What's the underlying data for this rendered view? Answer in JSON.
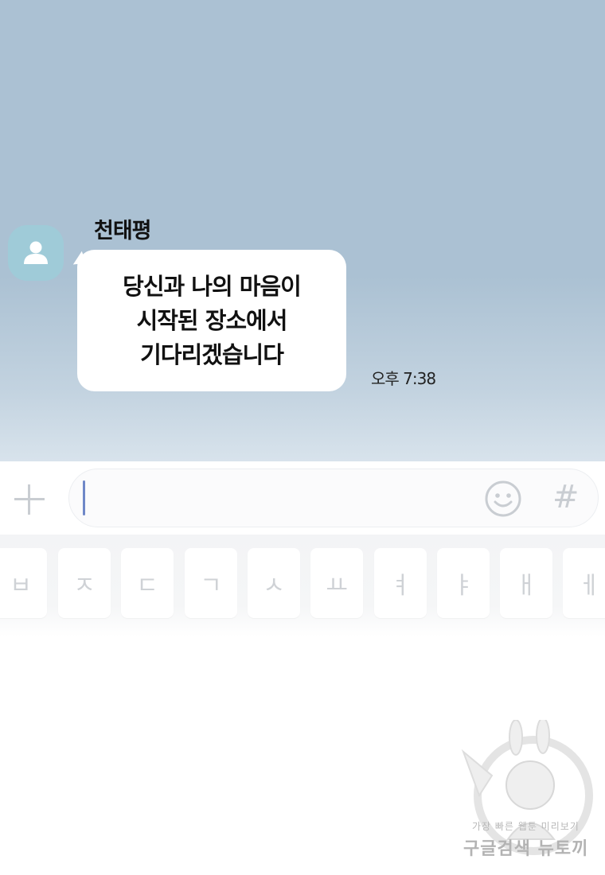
{
  "chat": {
    "sender_name": "천태평",
    "message_lines": [
      "당신과 나의 마음이",
      "시작된 장소에서",
      "기다리겠습니다"
    ],
    "timestamp": "오후 7:38"
  },
  "input_bar": {
    "plus_icon": "plus-icon",
    "emoji_icon": "smiley-icon",
    "hash_label": "#"
  },
  "keyboard": {
    "keys": [
      "ㅂ",
      "ㅈ",
      "ㄷ",
      "ㄱ",
      "ㅅ",
      "ㅛ",
      "ㅕ",
      "ㅑ",
      "ㅐ",
      "ㅔ"
    ]
  },
  "watermark": {
    "line1": "가장 빠른 웹툰 미리보기",
    "line2": "구글검색 뉴토끼"
  },
  "colors": {
    "chat_background": "#abc1d3",
    "avatar_background": "#9fcbd8",
    "bubble": "#ffffff",
    "caret": "#6f88c8"
  }
}
